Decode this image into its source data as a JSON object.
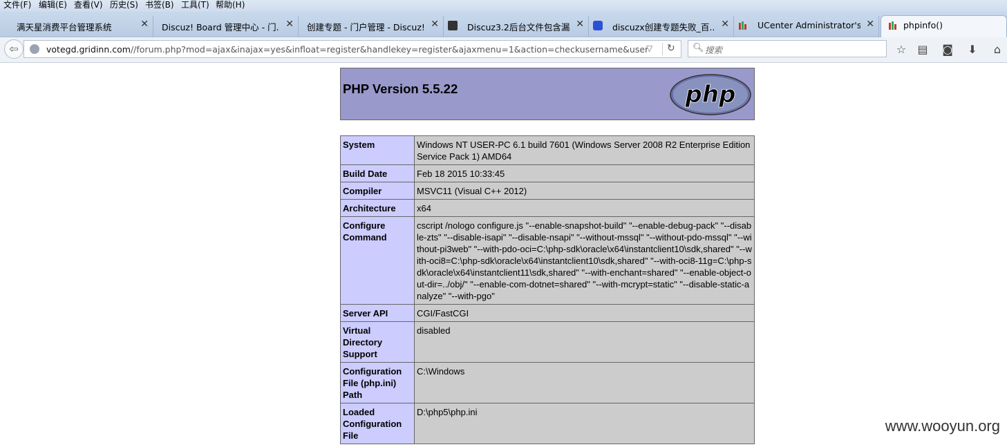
{
  "menubar": [
    {
      "label": "文件(F)"
    },
    {
      "label": "编辑(E)"
    },
    {
      "label": "查看(V)"
    },
    {
      "label": "历史(S)"
    },
    {
      "label": "书签(B)"
    },
    {
      "label": "工具(T)"
    },
    {
      "label": "帮助(H)"
    }
  ],
  "tabs": [
    {
      "label": "满天星消费平台管理系统",
      "icon": "none"
    },
    {
      "label": "Discuz! Board 管理中心 - 门...",
      "icon": "none"
    },
    {
      "label": "创建专题 - 门户管理 - Discuz!...",
      "icon": "none"
    },
    {
      "label": "Discuz3.2后台文件包含漏...",
      "icon": "wooyun-icon"
    },
    {
      "label": "discuzx创建专题失败_百...",
      "icon": "baidu-paw-icon"
    },
    {
      "label": "UCenter Administrator's ...",
      "icon": "ucenter-icon"
    },
    {
      "label": "phpinfo()",
      "icon": "ucenter-icon",
      "active": true
    }
  ],
  "nav": {
    "url_host": "votegd.gridinn.com",
    "url_path": "//forum.php?mod=ajax&inajax=yes&infloat=register&handlekey=register&ajaxmenu=1&action=checkusername&username=adn",
    "search_placeholder": "搜索"
  },
  "php": {
    "version": "PHP Version 5.5.22",
    "logo_text": "php",
    "rows": [
      {
        "key": "System",
        "value": "Windows NT USER-PC 6.1 build 7601 (Windows Server 2008 R2 Enterprise Edition Service Pack 1) AMD64"
      },
      {
        "key": "Build Date",
        "value": "Feb 18 2015 10:33:45"
      },
      {
        "key": "Compiler",
        "value": "MSVC11 (Visual C++ 2012)"
      },
      {
        "key": "Architecture",
        "value": "x64"
      },
      {
        "key": "Configure Command",
        "value": "cscript /nologo configure.js \"--enable-snapshot-build\" \"--enable-debug-pack\" \"--disable-zts\" \"--disable-isapi\" \"--disable-nsapi\" \"--without-mssql\" \"--without-pdo-mssql\" \"--without-pi3web\" \"--with-pdo-oci=C:\\php-sdk\\oracle\\x64\\instantclient10\\sdk,shared\" \"--with-oci8=C:\\php-sdk\\oracle\\x64\\instantclient10\\sdk,shared\" \"--with-oci8-11g=C:\\php-sdk\\oracle\\x64\\instantclient11\\sdk,shared\" \"--with-enchant=shared\" \"--enable-object-out-dir=../obj/\" \"--enable-com-dotnet=shared\" \"--with-mcrypt=static\" \"--disable-static-analyze\" \"--with-pgo\""
      },
      {
        "key": "Server API",
        "value": "CGI/FastCGI"
      },
      {
        "key": "Virtual Directory Support",
        "value": "disabled"
      },
      {
        "key": "Configuration File (php.ini) Path",
        "value": "C:\\Windows"
      },
      {
        "key": "Loaded Configuration File",
        "value": "D:\\php5\\php.ini"
      }
    ]
  },
  "watermark": "www.wooyun.org"
}
